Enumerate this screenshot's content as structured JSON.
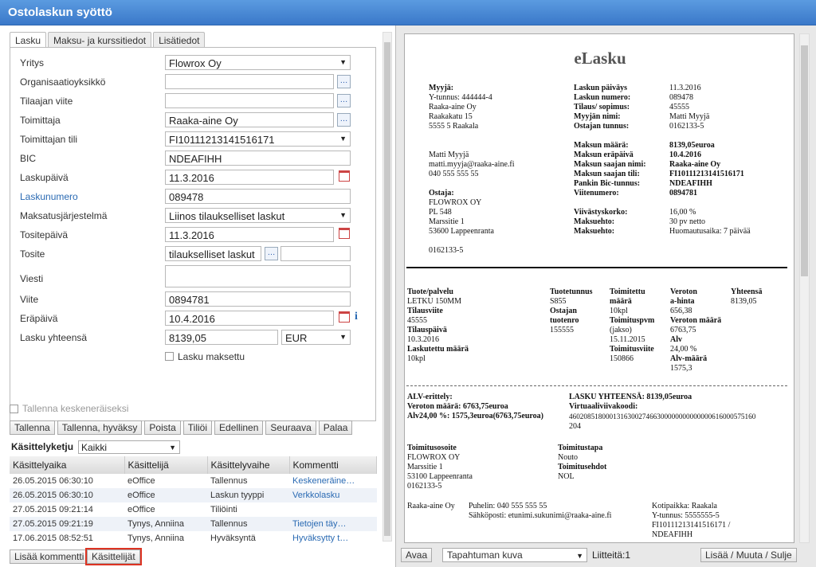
{
  "window": {
    "title": "Ostolaskun syöttö"
  },
  "tabs": [
    "Lasku",
    "Maksu- ja kurssitiedot",
    "Lisätiedot"
  ],
  "form": {
    "yritys": {
      "label": "Yritys",
      "value": "Flowrox Oy"
    },
    "org": {
      "label": "Organisaatioyksikkö",
      "value": ""
    },
    "tilaajan_viite": {
      "label": "Tilaajan viite",
      "value": ""
    },
    "toimittaja": {
      "label": "Toimittaja",
      "value": "Raaka-aine Oy"
    },
    "toimittajan_tili": {
      "label": "Toimittajan tili",
      "value": "FI10111213141516171"
    },
    "bic": {
      "label": "BIC",
      "value": "NDEAFIHH"
    },
    "laskupaiva": {
      "label": "Laskupäivä",
      "value": "11.3.2016"
    },
    "laskunumero": {
      "label": "Laskunumero",
      "value": "089478"
    },
    "maksatus": {
      "label": "Maksatusjärjestelmä",
      "value": "Liinos tilaukselliset laskut"
    },
    "tositepaiva": {
      "label": "Tositepäivä",
      "value": "11.3.2016"
    },
    "tosite": {
      "label": "Tosite",
      "value": "tilaukselliset laskut",
      "extra": ""
    },
    "viesti": {
      "label": "Viesti",
      "value": ""
    },
    "viite": {
      "label": "Viite",
      "value": "0894781"
    },
    "erapaiva": {
      "label": "Eräpäivä",
      "value": "10.4.2016"
    },
    "yhteensa": {
      "label": "Lasku yhteensä",
      "value": "8139,05",
      "currency": "EUR"
    },
    "maksettu": {
      "label": "Lasku maksettu",
      "checked": false
    },
    "tallenna_kesken": {
      "label": "Tallenna keskeneräiseksi",
      "checked": false
    }
  },
  "toolbar": [
    "Tallenna",
    "Tallenna, hyväksy",
    "Poista",
    "Tiliöi",
    "Edellinen",
    "Seuraava",
    "Palaa"
  ],
  "kasittely": {
    "title": "Käsittelyketju",
    "filter": "Kaikki",
    "columns": [
      "Käsittelyaika",
      "Käsittelijä",
      "Käsittelyvaihe",
      "Kommentti"
    ],
    "rows": [
      [
        "26.05.2015 06:30:10",
        "eOffice",
        "Tallennus",
        "Keskeneräine…"
      ],
      [
        "26.05.2015 06:30:10",
        "eOffice",
        "Laskun tyyppi",
        "Verkkolasku"
      ],
      [
        "27.05.2015 09:21:14",
        "eOffice",
        "Tiliöinti",
        ""
      ],
      [
        "27.05.2015 09:21:19",
        "Tynys, Anniina",
        "Tallennus",
        "Tietojen täy…"
      ],
      [
        "17.06.2015 08:52:51",
        "Tynys, Anniina",
        "Hyväksyntä",
        "Hyväksytty t…"
      ]
    ]
  },
  "bottom_left": {
    "add_comment": "Lisää kommentti",
    "handlers": "Käsittelijät"
  },
  "bottom_right": {
    "open": "Avaa",
    "doc_type": "Tapahtuman kuva",
    "attachments": "Liitteitä:1",
    "add": "Lisää / Muuta / Sulje"
  },
  "einvoice": {
    "title": "eLasku",
    "seller_block": [
      "Myyjä:",
      "Y-tunnus: 444444-4",
      "Raaka-aine Oy",
      "Raakakatu 15",
      "5555 5 Raakala",
      "",
      "Matti Myyjä",
      "matti.myyja@raaka-aine.fi",
      "040 555 555 55"
    ],
    "buyer_block": [
      "Ostaja:",
      "FLOWROX OY",
      "PL 548",
      "Marssitie 1",
      "53600 Lappeenranta",
      "",
      "0162133-5"
    ],
    "info_labels": [
      "Laskun päiväys",
      "Laskun numero:",
      "Tilaus/ sopimus:",
      "Myyjän nimi:",
      "Ostajan tunnus:",
      "",
      "Maksun määrä:",
      "Maksun eräpäivä",
      "Maksun saajan nimi:",
      "Maksun saajan tili:",
      "Pankin Bic-tunnus:",
      "Viitenumero:",
      "",
      "Viivästyskorko:",
      "Maksuehto:",
      "Maksuehto:"
    ],
    "info_values": [
      "11.3.2016",
      "089478",
      "45555",
      "Matti Myyjä",
      "0162133-5",
      "",
      "8139,05euroa",
      "10.4.2016",
      "Raaka-aine Oy",
      "FI10111213141516171",
      "NDEAFIHH",
      "0894781",
      "",
      "16,00 %",
      "30 pv netto",
      "Huomautusaika: 7 päivää"
    ],
    "rows_col1": [
      "Tuote/palvelu",
      "LETKU 150MM",
      "Tilausviite",
      "45555",
      "Tilauspäivä",
      "10.3.2016",
      "Laskutettu määrä",
      "10kpl"
    ],
    "rows_col2": [
      "Tuotetunnus",
      "S855",
      "Ostajan",
      "tuotenro",
      "155555"
    ],
    "rows_col3": [
      "Toimitettu",
      "määrä",
      "10kpl",
      "Toimituspvm",
      "(jakso)",
      "15.11.2015",
      "Toimitusviite",
      "150866"
    ],
    "rows_col4": [
      "Veroton",
      "a-hinta",
      "656,38",
      "Veroton määrä",
      "6763,75",
      "Alv",
      "24,00 %",
      "Alv-määrä",
      "1575,3"
    ],
    "rows_col5": [
      "Yhteensä",
      "8139,05"
    ],
    "alv_block": [
      "ALV-erittely:",
      "Veroton määrä: 6763,75euroa",
      "Alv24,00 %:      1575,3euroa(6763,75euroa)"
    ],
    "total_block": [
      "LASKU YHTEENSÄ: 8139,05euroa",
      "Virtuaaliviivakoodi:",
      "460208518000131630027466300000000000000616000575160",
      "204"
    ],
    "delivery_addr": [
      "Toimitusosoite",
      "FLOWROX OY",
      "Marssitie 1",
      "53100 Lappeenranta",
      "0162133-5"
    ],
    "delivery_terms": [
      "Toimitustapa",
      "Nouto",
      "Toimitusehdot",
      "NOL"
    ],
    "footer_left": "Raaka-aine Oy",
    "footer_mid": [
      "Puhelin: 040 555 555 55",
      "Sähköposti: etunimi.sukunimi@raaka-aine.fi"
    ],
    "footer_right": [
      "Kotipaikka: Raakala",
      "Y-tunnus: 5555555-5",
      "FI10111213141516171 /",
      "NDEAFIHH"
    ]
  }
}
